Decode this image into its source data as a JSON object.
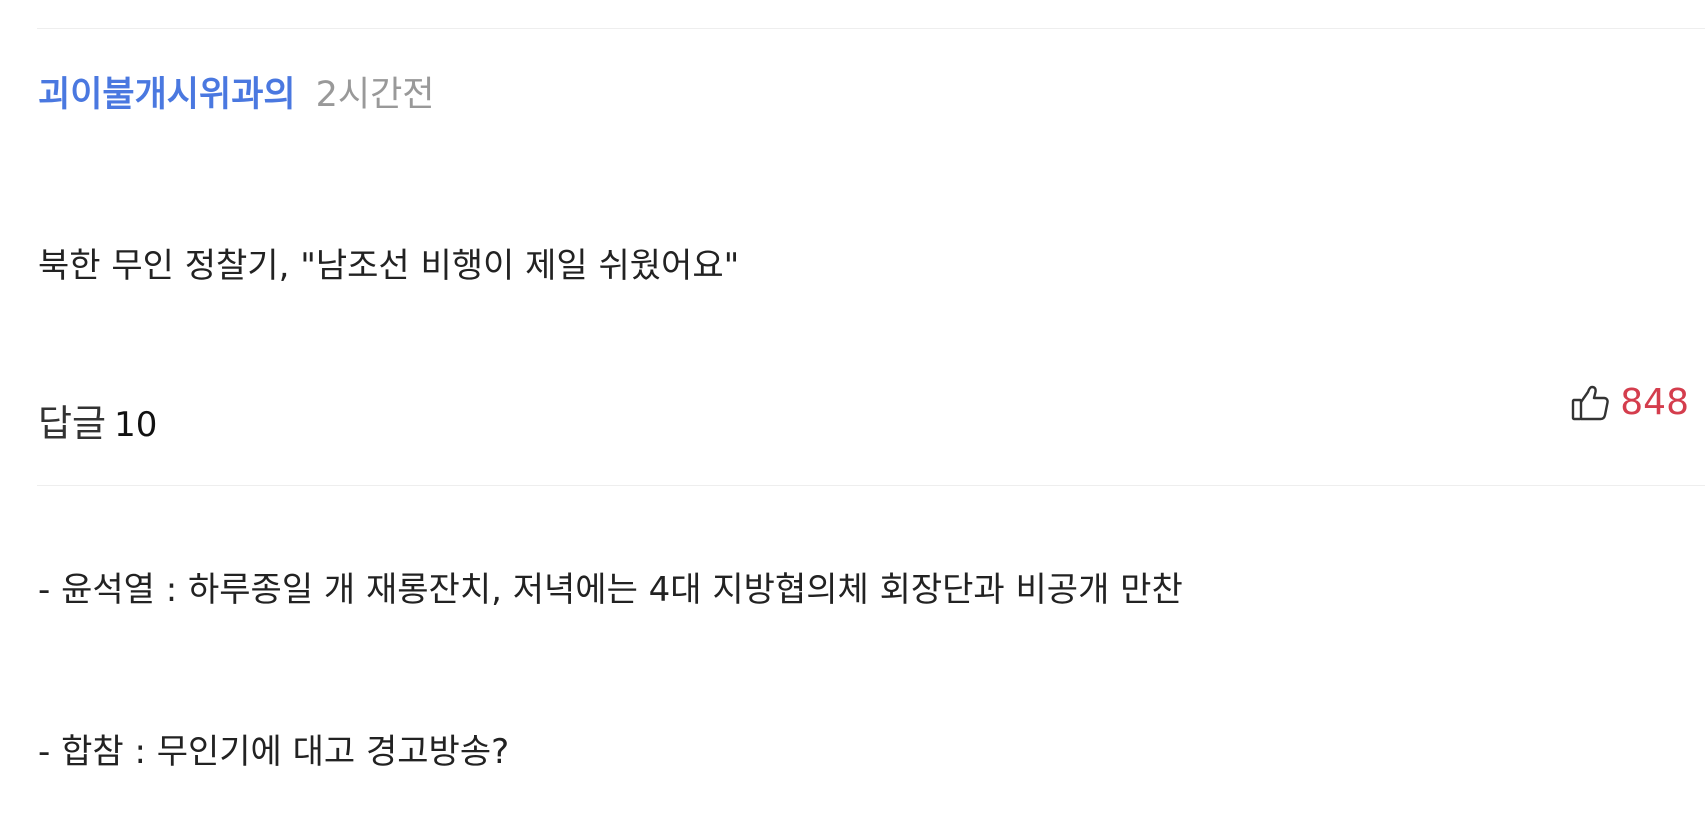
{
  "comment": {
    "author": "괴이불개시위과의",
    "time": "2시간전",
    "body_lines": [
      "북한 무인 정찰기, \"남조선 비행이 제일 쉬웠어요\"",
      "",
      "- 윤석열 : 하루종일 개 재롱잔치, 저녁에는 4대 지방협의체 회장단과 비공개 만찬",
      "- 합참 : 무인기에 대고 경고방송?"
    ],
    "reply_label": "답글",
    "reply_count": "10",
    "like_count": "848",
    "like_icon": "thumbs-up-icon"
  },
  "colors": {
    "author": "#4a78e0",
    "time": "#999999",
    "like_count": "#d43d4d",
    "body_text": "#222222"
  }
}
